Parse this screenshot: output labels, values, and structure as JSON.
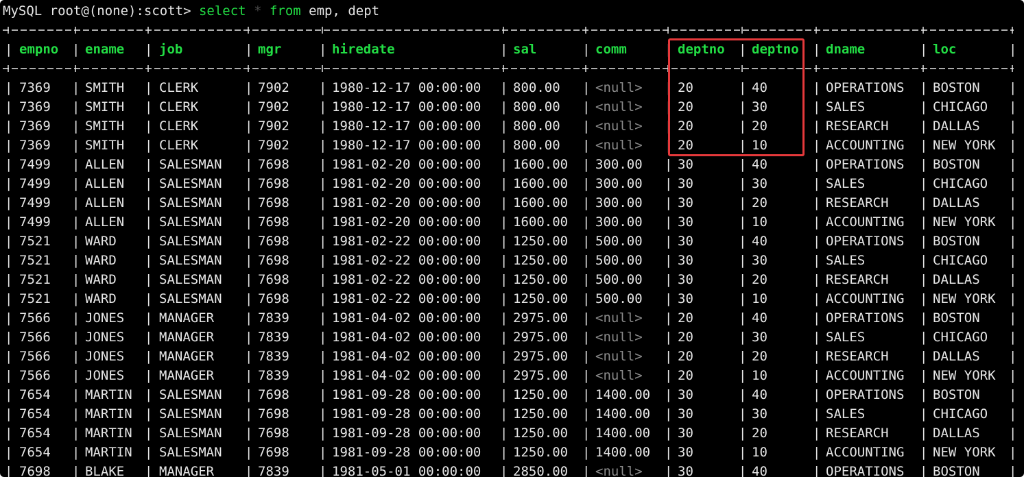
{
  "prompt": "MySQL root@(none):scott> ",
  "command": {
    "kw_select": "select",
    "star": " * ",
    "kw_from": "from",
    "rest": " emp, dept"
  },
  "table": {
    "columns": [
      "empno",
      "ename",
      "job",
      "mgr",
      "hiredate",
      "sal",
      "comm",
      "deptno",
      "deptno",
      "dname",
      "loc"
    ],
    "rows": [
      [
        "7369",
        "SMITH",
        "CLERK",
        "7902",
        "1980-12-17 00:00:00",
        "800.00",
        "<null>",
        "20",
        "40",
        "OPERATIONS",
        "BOSTON"
      ],
      [
        "7369",
        "SMITH",
        "CLERK",
        "7902",
        "1980-12-17 00:00:00",
        "800.00",
        "<null>",
        "20",
        "30",
        "SALES",
        "CHICAGO"
      ],
      [
        "7369",
        "SMITH",
        "CLERK",
        "7902",
        "1980-12-17 00:00:00",
        "800.00",
        "<null>",
        "20",
        "20",
        "RESEARCH",
        "DALLAS"
      ],
      [
        "7369",
        "SMITH",
        "CLERK",
        "7902",
        "1980-12-17 00:00:00",
        "800.00",
        "<null>",
        "20",
        "10",
        "ACCOUNTING",
        "NEW YORK"
      ],
      [
        "7499",
        "ALLEN",
        "SALESMAN",
        "7698",
        "1981-02-20 00:00:00",
        "1600.00",
        "300.00",
        "30",
        "40",
        "OPERATIONS",
        "BOSTON"
      ],
      [
        "7499",
        "ALLEN",
        "SALESMAN",
        "7698",
        "1981-02-20 00:00:00",
        "1600.00",
        "300.00",
        "30",
        "30",
        "SALES",
        "CHICAGO"
      ],
      [
        "7499",
        "ALLEN",
        "SALESMAN",
        "7698",
        "1981-02-20 00:00:00",
        "1600.00",
        "300.00",
        "30",
        "20",
        "RESEARCH",
        "DALLAS"
      ],
      [
        "7499",
        "ALLEN",
        "SALESMAN",
        "7698",
        "1981-02-20 00:00:00",
        "1600.00",
        "300.00",
        "30",
        "10",
        "ACCOUNTING",
        "NEW YORK"
      ],
      [
        "7521",
        "WARD",
        "SALESMAN",
        "7698",
        "1981-02-22 00:00:00",
        "1250.00",
        "500.00",
        "30",
        "40",
        "OPERATIONS",
        "BOSTON"
      ],
      [
        "7521",
        "WARD",
        "SALESMAN",
        "7698",
        "1981-02-22 00:00:00",
        "1250.00",
        "500.00",
        "30",
        "30",
        "SALES",
        "CHICAGO"
      ],
      [
        "7521",
        "WARD",
        "SALESMAN",
        "7698",
        "1981-02-22 00:00:00",
        "1250.00",
        "500.00",
        "30",
        "20",
        "RESEARCH",
        "DALLAS"
      ],
      [
        "7521",
        "WARD",
        "SALESMAN",
        "7698",
        "1981-02-22 00:00:00",
        "1250.00",
        "500.00",
        "30",
        "10",
        "ACCOUNTING",
        "NEW YORK"
      ],
      [
        "7566",
        "JONES",
        "MANAGER",
        "7839",
        "1981-04-02 00:00:00",
        "2975.00",
        "<null>",
        "20",
        "40",
        "OPERATIONS",
        "BOSTON"
      ],
      [
        "7566",
        "JONES",
        "MANAGER",
        "7839",
        "1981-04-02 00:00:00",
        "2975.00",
        "<null>",
        "20",
        "30",
        "SALES",
        "CHICAGO"
      ],
      [
        "7566",
        "JONES",
        "MANAGER",
        "7839",
        "1981-04-02 00:00:00",
        "2975.00",
        "<null>",
        "20",
        "20",
        "RESEARCH",
        "DALLAS"
      ],
      [
        "7566",
        "JONES",
        "MANAGER",
        "7839",
        "1981-04-02 00:00:00",
        "2975.00",
        "<null>",
        "20",
        "10",
        "ACCOUNTING",
        "NEW YORK"
      ],
      [
        "7654",
        "MARTIN",
        "SALESMAN",
        "7698",
        "1981-09-28 00:00:00",
        "1250.00",
        "1400.00",
        "30",
        "40",
        "OPERATIONS",
        "BOSTON"
      ],
      [
        "7654",
        "MARTIN",
        "SALESMAN",
        "7698",
        "1981-09-28 00:00:00",
        "1250.00",
        "1400.00",
        "30",
        "30",
        "SALES",
        "CHICAGO"
      ],
      [
        "7654",
        "MARTIN",
        "SALESMAN",
        "7698",
        "1981-09-28 00:00:00",
        "1250.00",
        "1400.00",
        "30",
        "20",
        "RESEARCH",
        "DALLAS"
      ],
      [
        "7654",
        "MARTIN",
        "SALESMAN",
        "7698",
        "1981-09-28 00:00:00",
        "1250.00",
        "1400.00",
        "30",
        "10",
        "ACCOUNTING",
        "NEW YORK"
      ],
      [
        "7698",
        "BLAKE",
        "MANAGER",
        "7839",
        "1981-05-01 00:00:00",
        "2850.00",
        "<null>",
        "30",
        "40",
        "OPERATIONS",
        "BOSTON"
      ]
    ],
    "null_token": "<null>"
  },
  "colors": {
    "background": "#000000",
    "text": "#e6e6e6",
    "keyword": "#22dd44",
    "null": "#8a8a8a",
    "highlight_box": "#e5393b"
  }
}
